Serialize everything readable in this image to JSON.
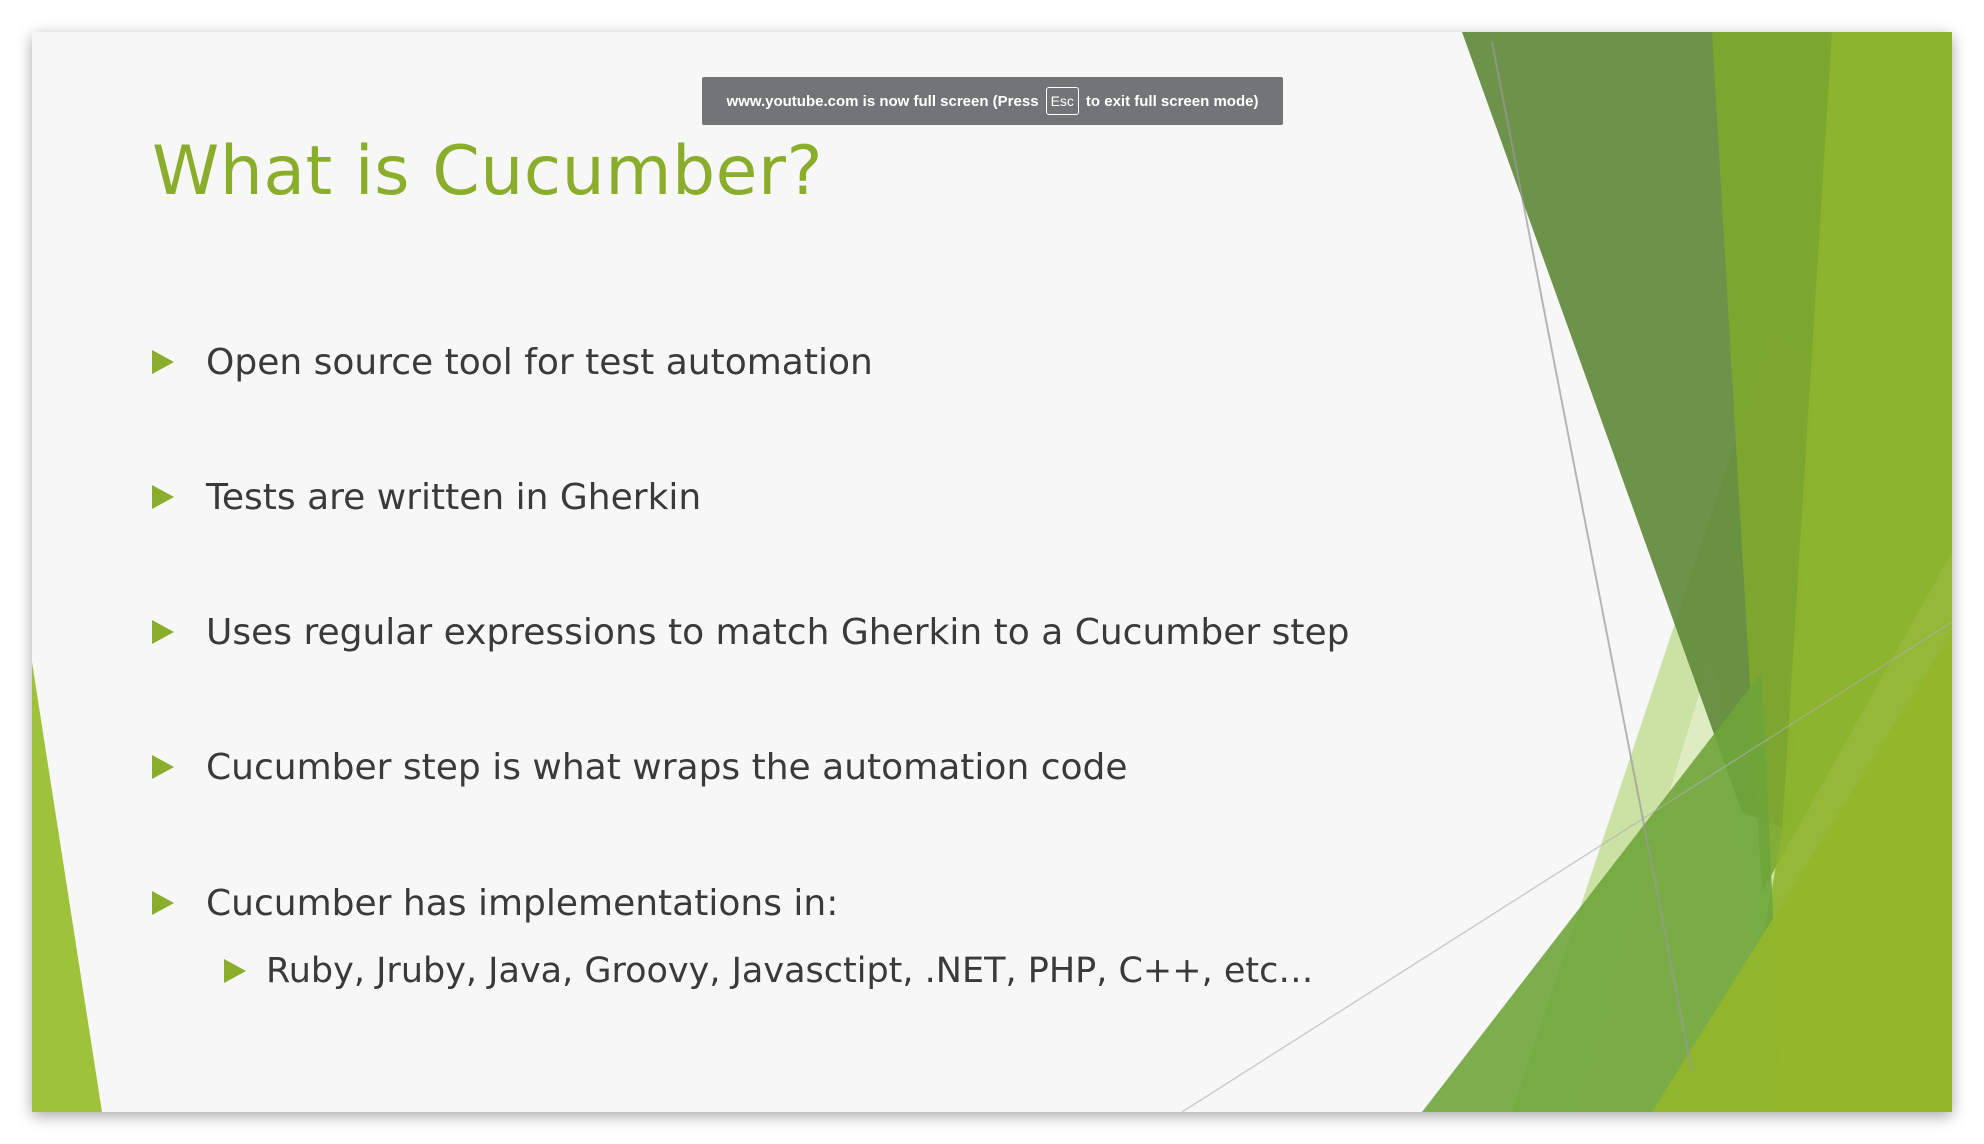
{
  "browser_notice": {
    "prefix": "www.youtube.com is now full screen (Press",
    "key": "Esc",
    "suffix": "to exit full screen mode)"
  },
  "slide": {
    "title": "What is Cucumber?",
    "bullets": [
      "Open source tool for test automation",
      "Tests are written in Gherkin",
      "Uses regular expressions to match Gherkin to a Cucumber step",
      "Cucumber step is what wraps the automation code",
      "Cucumber has implementations in:"
    ],
    "sub_bullets": [
      "Ruby, Jruby, Java, Groovy, Javasctipt, .NET, PHP, C++, etc…"
    ]
  },
  "colors": {
    "accent_green": "#8aad2c",
    "text": "#3a3a3a",
    "background": "#f7f7f7",
    "toast": "#737475"
  },
  "icons": {
    "bullet": "triangle-right-icon"
  }
}
